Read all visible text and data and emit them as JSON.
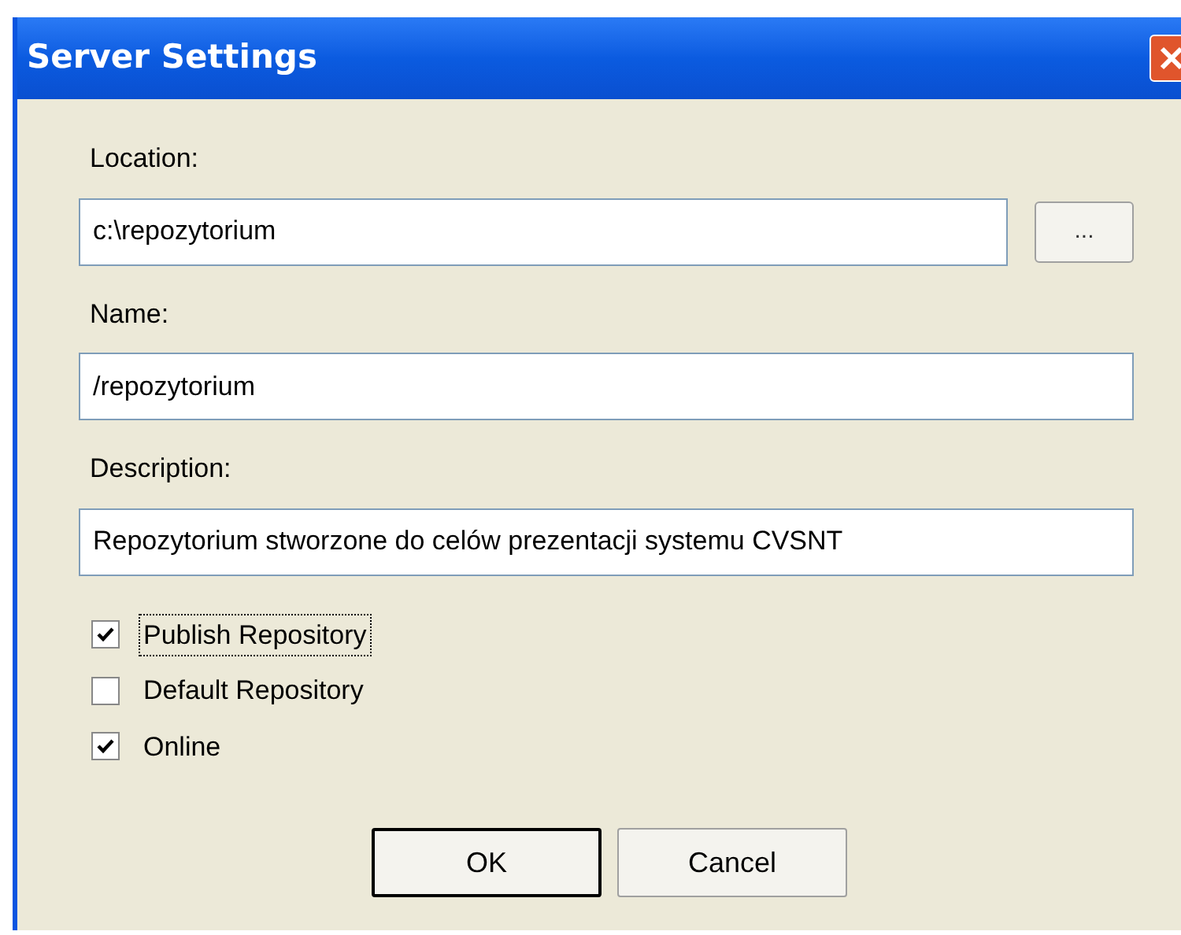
{
  "window": {
    "title": "Server Settings"
  },
  "fields": [
    {
      "label": "Location:",
      "value": "c:\\repozytorium",
      "browse": "..."
    },
    {
      "label": "Name:",
      "value": "/repozytorium"
    },
    {
      "label": "Description:",
      "value": "Repozytorium stworzone do celów prezentacji systemu CVSNT"
    }
  ],
  "checkboxes": [
    {
      "label": "Publish Repository",
      "checked": true,
      "focused": true
    },
    {
      "label": "Default Repository",
      "checked": false,
      "focused": false
    },
    {
      "label": "Online",
      "checked": true,
      "focused": false
    }
  ],
  "buttons": [
    {
      "label": "OK",
      "default": true
    },
    {
      "label": "Cancel",
      "default": false
    }
  ]
}
